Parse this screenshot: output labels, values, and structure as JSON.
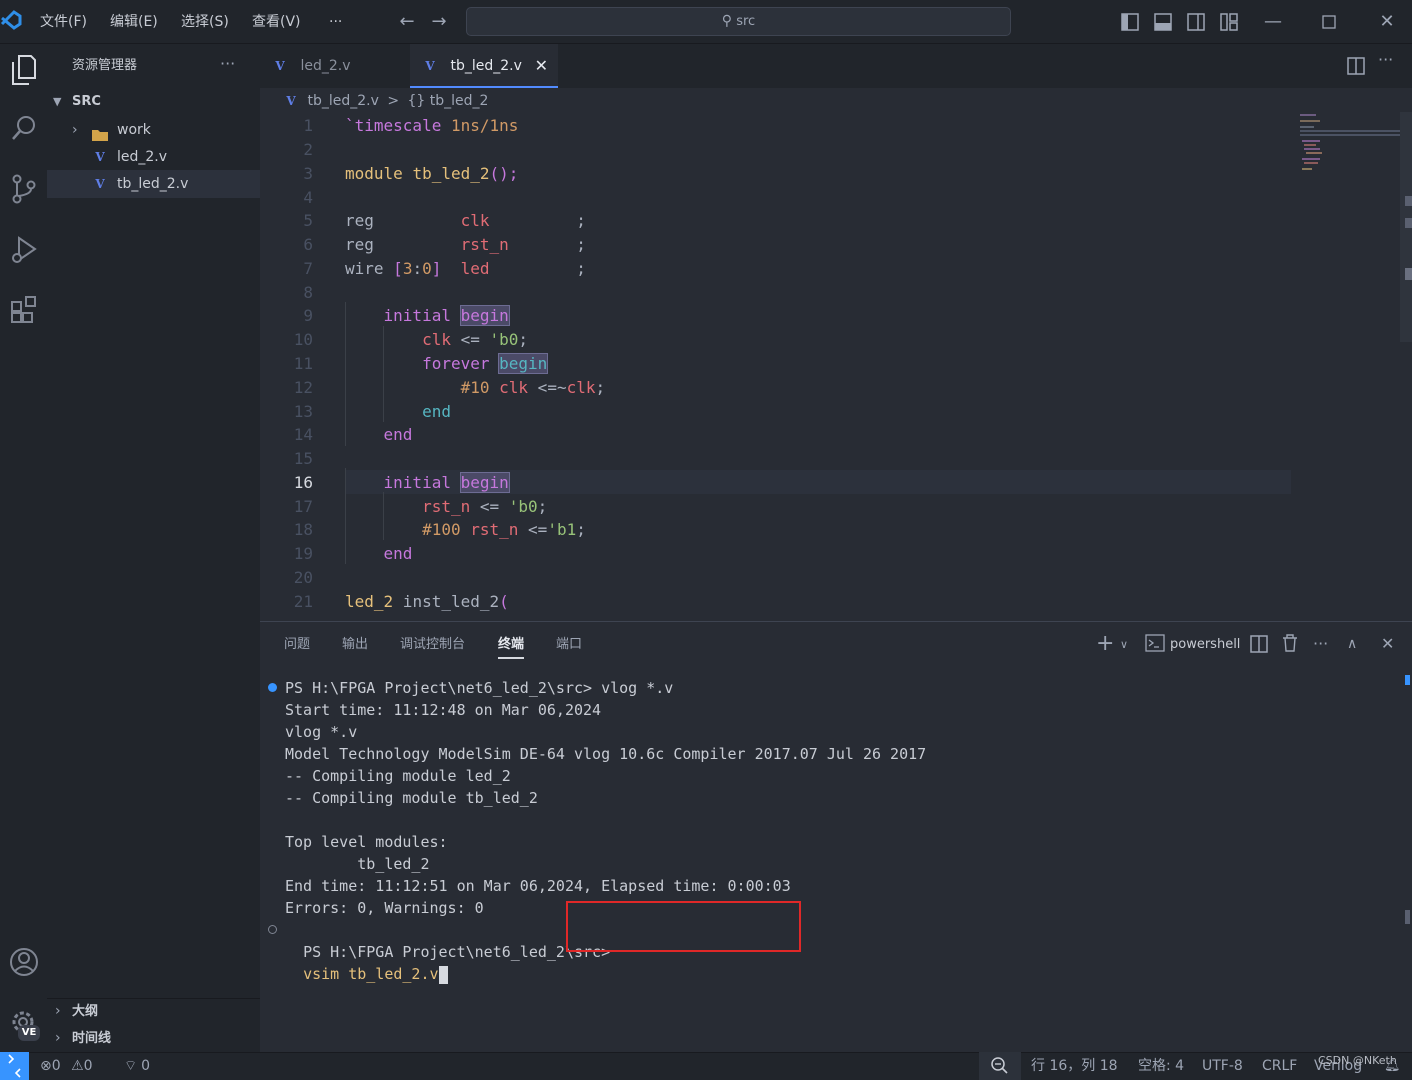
{
  "menu": [
    "文件(F)",
    "编辑(E)",
    "选择(S)",
    "查看(V)",
    "···"
  ],
  "search": {
    "text": "src"
  },
  "sidebar": {
    "title": "资源管理器",
    "more": "···",
    "folder": "SRC",
    "items": [
      {
        "label": "work",
        "type": "folder"
      },
      {
        "label": "led_2.v",
        "type": "file"
      },
      {
        "label": "tb_led_2.v",
        "type": "file"
      }
    ],
    "outline": "大纲",
    "timeline": "时间线"
  },
  "tabs": [
    {
      "label": "led_2.v",
      "active": false
    },
    {
      "label": "tb_led_2.v",
      "active": true
    }
  ],
  "breadcrumb": {
    "file": "tb_led_2.v",
    "sep": ">",
    "symbol": "{} tb_led_2"
  },
  "code_lines": [
    {
      "n": "1"
    },
    {
      "n": "2"
    },
    {
      "n": "3"
    },
    {
      "n": "4"
    },
    {
      "n": "5"
    },
    {
      "n": "6"
    },
    {
      "n": "7"
    },
    {
      "n": "8"
    },
    {
      "n": "9"
    },
    {
      "n": "10"
    },
    {
      "n": "11"
    },
    {
      "n": "12"
    },
    {
      "n": "13"
    },
    {
      "n": "14"
    },
    {
      "n": "15"
    },
    {
      "n": "16"
    },
    {
      "n": "17"
    },
    {
      "n": "18"
    },
    {
      "n": "19"
    },
    {
      "n": "20"
    },
    {
      "n": "21"
    }
  ],
  "panel": {
    "tabs": [
      "问题",
      "输出",
      "调试控制台",
      "终端",
      "端口"
    ],
    "active_tab": "终端",
    "shell": "powershell",
    "lines": [
      "PS H:\\FPGA Project\\net6_led_2\\src> vlog *.v",
      "Start time: 11:12:48 on Mar 06,2024",
      "vlog *.v",
      "Model Technology ModelSim DE-64 vlog 10.6c Compiler 2017.07 Jul 26 2017",
      "-- Compiling module led_2",
      "-- Compiling module tb_led_2",
      "",
      "Top level modules:",
      "        tb_led_2",
      "End time: 11:12:51 on Mar 06,2024, Elapsed time: 0:00:03",
      "Errors: 0, Warnings: 0"
    ],
    "prompt": "PS H:\\FPGA Project\\net6_led_2\\src>",
    "command": "vsim tb_led_2.v"
  },
  "status": {
    "errors": "0",
    "warnings": "0",
    "ports": "0",
    "position": "行 16，列 18",
    "spaces": "空格: 4",
    "encoding": "UTF-8",
    "eol": "CRLF",
    "language": "Verilog",
    "watermark": "CSDN @NKeth",
    "account_badge": "VE"
  },
  "colors": {
    "accent": "#007acc",
    "highlight_box": "#e02828"
  }
}
